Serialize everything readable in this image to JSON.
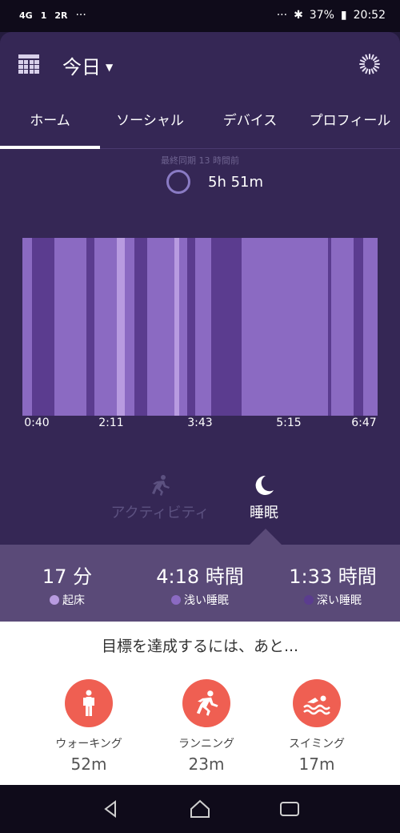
{
  "status_bar": {
    "network_label": "4G",
    "sim1": "1",
    "sim2": "2R",
    "overflow_left": "···",
    "overflow_right": "···",
    "battery": "37%",
    "time": "20:52"
  },
  "header": {
    "title": "今日"
  },
  "tabs": [
    {
      "label": "ホーム",
      "active": true
    },
    {
      "label": "ソーシャル",
      "active": false
    },
    {
      "label": "デバイス",
      "active": false
    },
    {
      "label": "プロフィール",
      "active": false
    }
  ],
  "sync": {
    "last_sync": "最終同期 13 時間前"
  },
  "sleep": {
    "duration": "5h 51m"
  },
  "chart_data": {
    "type": "bar",
    "x_tick_labels": [
      "0:40",
      "2:11",
      "3:43",
      "5:15",
      "6:47"
    ],
    "stages": [
      "awake",
      "light",
      "deep"
    ],
    "colors": {
      "awake": "#b89be0",
      "light": "#8b6ac2",
      "deep": "#5b3c8f"
    }
  },
  "modes": {
    "activity_label": "アクティビティ",
    "sleep_label": "睡眠"
  },
  "stats": [
    {
      "value": "17 分",
      "label": "起床",
      "color": "#b89be0"
    },
    {
      "value": "4:18 時間",
      "label": "浅い睡眠",
      "color": "#8b6ac2"
    },
    {
      "value": "1:33 時間",
      "label": "深い睡眠",
      "color": "#5b3c8f"
    }
  ],
  "goals": {
    "title": "目標を達成するには、あと...",
    "items": [
      {
        "label": "ウォーキング",
        "value": "52m",
        "icon": "walk-icon"
      },
      {
        "label": "ランニング",
        "value": "23m",
        "icon": "run-icon"
      },
      {
        "label": "スイミング",
        "value": "17m",
        "icon": "swim-icon"
      }
    ]
  }
}
